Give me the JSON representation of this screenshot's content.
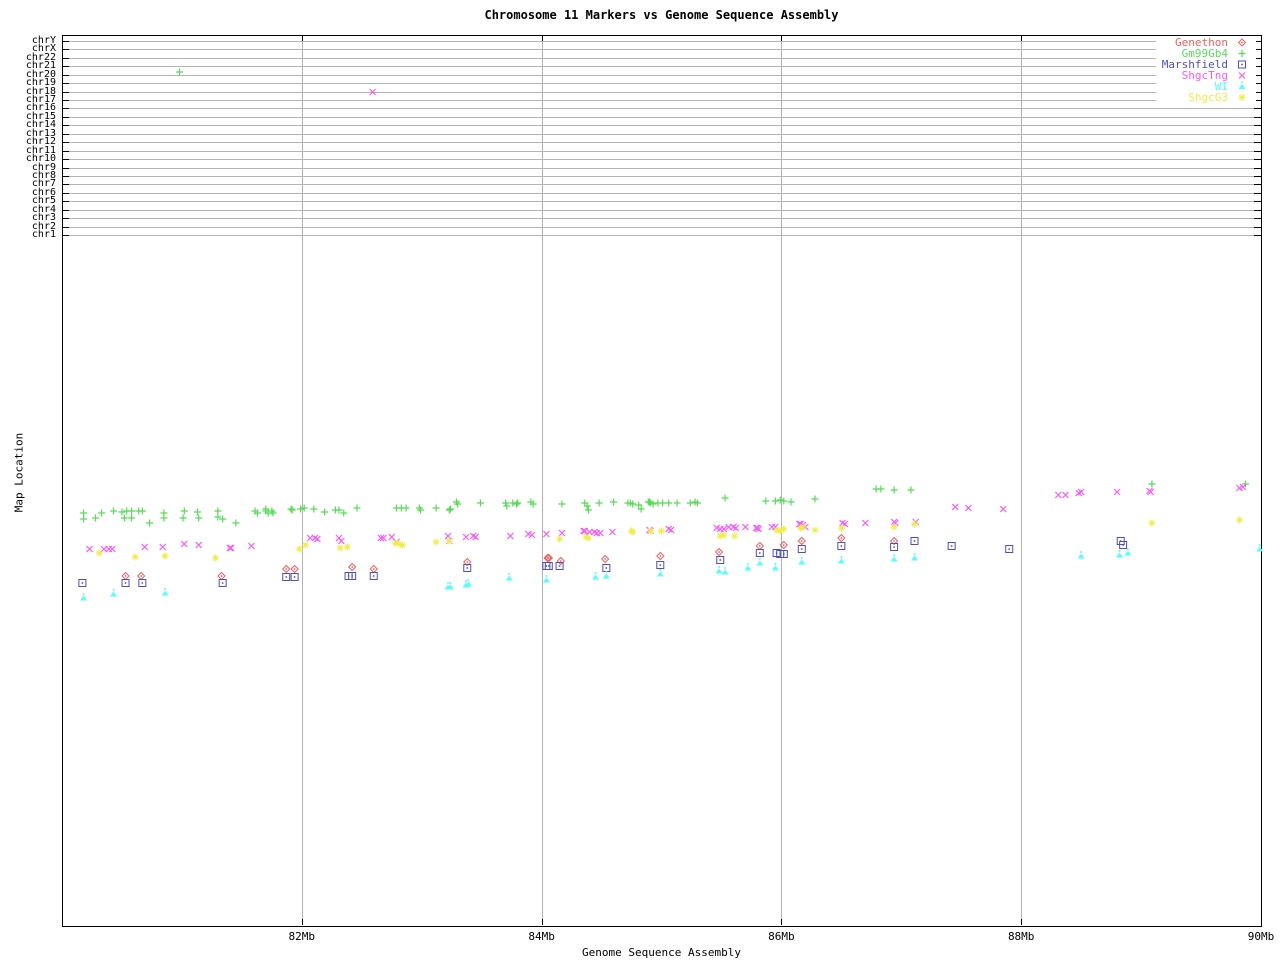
{
  "chart_data": {
    "type": "scatter",
    "title": "Chromosome 11 Markers vs Genome Sequence Assembly",
    "xlabel": "Genome Sequence Assembly",
    "ylabel": "Map Location",
    "xlim": [
      80,
      90
    ],
    "x_ticks": [
      {
        "mb": 82,
        "label": "82Mb"
      },
      {
        "mb": 84,
        "label": "84Mb"
      },
      {
        "mb": 86,
        "label": "86Mb"
      },
      {
        "mb": 88,
        "label": "88Mb"
      },
      {
        "mb": 90,
        "label": "90Mb"
      }
    ],
    "y_axis_rows": [
      "chrY",
      "chrX",
      "chr22",
      "chr21",
      "chr20",
      "chr19",
      "chr18",
      "chr17",
      "chr16",
      "chr15",
      "chr14",
      "chr13",
      "chr12",
      "chr11",
      "chr10",
      "chr9",
      "chr8",
      "chr7",
      "chr6",
      "chr5",
      "chr4",
      "chr3",
      "chr2",
      "chr1"
    ],
    "grid": true,
    "legend_position": "top-right",
    "y_units": "screen_px (map-location axis is unlabeled; chromosome rows at top)",
    "grid_color": "#b3b3b3",
    "series": [
      {
        "name": "Genethon",
        "marker": "diamond-open-dot",
        "color": "#ee5f5f",
        "points": [
          [
            80.53,
            576
          ],
          [
            80.66,
            576
          ],
          [
            81.33,
            576
          ],
          [
            81.87,
            569
          ],
          [
            81.94,
            569
          ],
          [
            82.42,
            567
          ],
          [
            82.6,
            569
          ],
          [
            83.38,
            562
          ],
          [
            84.05,
            558
          ],
          [
            84.06,
            558
          ],
          [
            84.16,
            561
          ],
          [
            84.53,
            559
          ],
          [
            84.99,
            556
          ],
          [
            85.48,
            552
          ],
          [
            85.82,
            546
          ],
          [
            86.02,
            545
          ],
          [
            86.17,
            541
          ],
          [
            86.5,
            538
          ],
          [
            86.94,
            541
          ]
        ]
      },
      {
        "name": "Gm99Gb4",
        "marker": "plus",
        "color": "#55dd55",
        "points": [
          [
            80.18,
            513
          ],
          [
            80.18,
            519
          ],
          [
            80.28,
            518
          ],
          [
            80.33,
            513
          ],
          [
            80.43,
            511
          ],
          [
            80.5,
            512
          ],
          [
            80.52,
            518
          ],
          [
            80.54,
            511
          ],
          [
            80.58,
            511
          ],
          [
            80.58,
            518
          ],
          [
            80.64,
            511
          ],
          [
            80.67,
            511
          ],
          [
            80.73,
            523
          ],
          [
            80.85,
            513
          ],
          [
            80.85,
            518
          ],
          [
            80.98,
            72
          ],
          [
            81.01,
            518
          ],
          [
            81.02,
            511
          ],
          [
            81.13,
            512
          ],
          [
            81.14,
            518
          ],
          [
            81.3,
            511
          ],
          [
            81.3,
            517
          ],
          [
            81.34,
            519
          ],
          [
            81.45,
            523
          ],
          [
            81.61,
            511
          ],
          [
            81.63,
            513
          ],
          [
            81.7,
            509
          ],
          [
            81.7,
            511
          ],
          [
            81.72,
            513
          ],
          [
            81.75,
            511
          ],
          [
            81.76,
            513
          ],
          [
            81.91,
            509
          ],
          [
            81.92,
            510
          ],
          [
            81.99,
            509
          ],
          [
            82.02,
            508
          ],
          [
            82.1,
            509
          ],
          [
            82.19,
            512
          ],
          [
            82.28,
            510
          ],
          [
            82.31,
            510
          ],
          [
            82.35,
            513
          ],
          [
            82.46,
            508
          ],
          [
            82.79,
            508
          ],
          [
            82.83,
            508
          ],
          [
            82.87,
            508
          ],
          [
            82.98,
            508
          ],
          [
            82.99,
            510
          ],
          [
            83.12,
            508
          ],
          [
            83.23,
            510
          ],
          [
            83.24,
            509
          ],
          [
            83.29,
            502
          ],
          [
            83.3,
            504
          ],
          [
            83.49,
            503
          ],
          [
            83.7,
            503
          ],
          [
            83.71,
            506
          ],
          [
            83.76,
            503
          ],
          [
            83.79,
            504
          ],
          [
            83.8,
            503
          ],
          [
            83.91,
            502
          ],
          [
            83.93,
            504
          ],
          [
            84.17,
            504
          ],
          [
            84.36,
            503
          ],
          [
            84.38,
            506
          ],
          [
            84.39,
            510
          ],
          [
            84.48,
            503
          ],
          [
            84.6,
            502
          ],
          [
            84.72,
            503
          ],
          [
            84.74,
            503
          ],
          [
            84.76,
            504
          ],
          [
            84.81,
            505
          ],
          [
            84.83,
            509
          ],
          [
            84.89,
            502
          ],
          [
            84.9,
            502
          ],
          [
            84.91,
            503
          ],
          [
            84.93,
            504
          ],
          [
            84.97,
            503
          ],
          [
            85.01,
            503
          ],
          [
            85.06,
            503
          ],
          [
            85.13,
            503
          ],
          [
            85.24,
            503
          ],
          [
            85.28,
            502
          ],
          [
            85.3,
            503
          ],
          [
            85.53,
            498
          ],
          [
            85.87,
            501
          ],
          [
            85.95,
            501
          ],
          [
            85.99,
            500
          ],
          [
            86.02,
            501
          ],
          [
            86.08,
            502
          ],
          [
            86.28,
            499
          ],
          [
            86.79,
            489
          ],
          [
            86.83,
            489
          ],
          [
            86.94,
            490
          ],
          [
            87.08,
            490
          ],
          [
            89.09,
            484
          ],
          [
            89.87,
            484
          ]
        ]
      },
      {
        "name": "Marshfield",
        "marker": "square-open-dot",
        "color": "#4d4dcc",
        "points": [
          [
            80.17,
            583
          ],
          [
            80.53,
            583
          ],
          [
            80.67,
            583
          ],
          [
            81.34,
            583
          ],
          [
            81.87,
            577
          ],
          [
            81.94,
            577
          ],
          [
            82.39,
            576
          ],
          [
            82.42,
            576
          ],
          [
            82.6,
            576
          ],
          [
            83.38,
            568
          ],
          [
            84.04,
            566
          ],
          [
            84.06,
            566
          ],
          [
            84.15,
            566
          ],
          [
            84.54,
            568
          ],
          [
            84.99,
            565
          ],
          [
            85.49,
            560
          ],
          [
            85.82,
            553
          ],
          [
            85.96,
            553
          ],
          [
            85.99,
            554
          ],
          [
            86.02,
            554
          ],
          [
            86.17,
            549
          ],
          [
            86.5,
            546
          ],
          [
            86.94,
            547
          ],
          [
            87.11,
            541
          ],
          [
            87.42,
            546
          ],
          [
            87.9,
            549
          ],
          [
            88.83,
            541
          ],
          [
            88.85,
            545
          ]
        ]
      },
      {
        "name": "ShgcTng",
        "marker": "x-cross",
        "color": "#ff55ff",
        "points": [
          [
            80.23,
            549
          ],
          [
            80.35,
            549
          ],
          [
            80.39,
            549
          ],
          [
            80.42,
            549
          ],
          [
            80.69,
            547
          ],
          [
            80.84,
            547
          ],
          [
            81.02,
            544
          ],
          [
            81.14,
            545
          ],
          [
            81.4,
            548
          ],
          [
            81.41,
            548
          ],
          [
            81.58,
            546
          ],
          [
            82.07,
            538
          ],
          [
            82.11,
            538
          ],
          [
            82.13,
            539
          ],
          [
            82.31,
            538
          ],
          [
            82.33,
            541
          ],
          [
            82.59,
            92
          ],
          [
            82.66,
            538
          ],
          [
            82.68,
            538
          ],
          [
            82.75,
            537
          ],
          [
            82.79,
            542
          ],
          [
            83.22,
            536
          ],
          [
            83.23,
            541
          ],
          [
            83.37,
            537
          ],
          [
            83.43,
            536
          ],
          [
            83.45,
            537
          ],
          [
            83.74,
            536
          ],
          [
            83.89,
            534
          ],
          [
            83.92,
            535
          ],
          [
            84.04,
            534
          ],
          [
            84.17,
            533
          ],
          [
            84.35,
            531
          ],
          [
            84.36,
            531
          ],
          [
            84.4,
            532
          ],
          [
            84.44,
            532
          ],
          [
            84.46,
            533
          ],
          [
            84.49,
            533
          ],
          [
            84.59,
            532
          ],
          [
            84.9,
            530
          ],
          [
            84.91,
            531
          ],
          [
            85.06,
            529
          ],
          [
            85.08,
            530
          ],
          [
            85.46,
            528
          ],
          [
            85.49,
            529
          ],
          [
            85.52,
            529
          ],
          [
            85.56,
            527
          ],
          [
            85.6,
            527
          ],
          [
            85.62,
            528
          ],
          [
            85.7,
            527
          ],
          [
            85.79,
            528
          ],
          [
            85.8,
            528
          ],
          [
            85.81,
            529
          ],
          [
            85.92,
            527
          ],
          [
            85.95,
            527
          ],
          [
            86.15,
            524
          ],
          [
            86.16,
            524
          ],
          [
            86.18,
            525
          ],
          [
            86.2,
            527
          ],
          [
            86.51,
            523
          ],
          [
            86.53,
            524
          ],
          [
            86.7,
            523
          ],
          [
            86.94,
            522
          ],
          [
            86.95,
            523
          ],
          [
            87.12,
            522
          ],
          [
            87.45,
            507
          ],
          [
            87.56,
            508
          ],
          [
            87.85,
            509
          ],
          [
            88.31,
            495
          ],
          [
            88.37,
            495
          ],
          [
            88.48,
            493
          ],
          [
            88.5,
            492
          ],
          [
            88.8,
            492
          ],
          [
            89.07,
            491
          ],
          [
            89.08,
            492
          ],
          [
            89.82,
            488
          ],
          [
            89.85,
            487
          ]
        ]
      },
      {
        "name": "WI",
        "marker": "triangle-dot",
        "color": "#55ffff",
        "points": [
          [
            80.18,
            598
          ],
          [
            80.43,
            594
          ],
          [
            80.86,
            593
          ],
          [
            83.22,
            587
          ],
          [
            83.24,
            587
          ],
          [
            83.37,
            585
          ],
          [
            83.39,
            584
          ],
          [
            83.73,
            578
          ],
          [
            84.04,
            580
          ],
          [
            84.45,
            577
          ],
          [
            84.54,
            576
          ],
          [
            84.99,
            574
          ],
          [
            85.48,
            571
          ],
          [
            85.53,
            572
          ],
          [
            85.72,
            568
          ],
          [
            85.82,
            563
          ],
          [
            85.95,
            568
          ],
          [
            86.17,
            562
          ],
          [
            86.5,
            561
          ],
          [
            86.94,
            559
          ],
          [
            87.11,
            558
          ],
          [
            88.5,
            556
          ],
          [
            88.82,
            555
          ],
          [
            88.89,
            553
          ],
          [
            89.99,
            549
          ]
        ]
      },
      {
        "name": "ShgcG3",
        "marker": "asterisk",
        "color": "#eeee44",
        "points": [
          [
            80.31,
            553
          ],
          [
            80.61,
            557
          ],
          [
            80.86,
            556
          ],
          [
            81.28,
            558
          ],
          [
            81.98,
            549
          ],
          [
            82.03,
            545
          ],
          [
            82.32,
            548
          ],
          [
            82.38,
            547
          ],
          [
            82.78,
            543
          ],
          [
            82.81,
            544
          ],
          [
            82.84,
            545
          ],
          [
            83.12,
            542
          ],
          [
            83.23,
            541
          ],
          [
            84.15,
            539
          ],
          [
            84.37,
            537
          ],
          [
            84.39,
            538
          ],
          [
            84.75,
            531
          ],
          [
            84.76,
            532
          ],
          [
            84.91,
            531
          ],
          [
            85.0,
            531
          ],
          [
            85.49,
            536
          ],
          [
            85.52,
            535
          ],
          [
            85.61,
            536
          ],
          [
            85.96,
            530
          ],
          [
            85.99,
            531
          ],
          [
            86.02,
            529
          ],
          [
            86.16,
            528
          ],
          [
            86.18,
            527
          ],
          [
            86.28,
            530
          ],
          [
            86.5,
            528
          ],
          [
            86.94,
            527
          ],
          [
            87.11,
            524
          ],
          [
            89.09,
            523
          ],
          [
            89.82,
            520
          ]
        ]
      }
    ]
  }
}
